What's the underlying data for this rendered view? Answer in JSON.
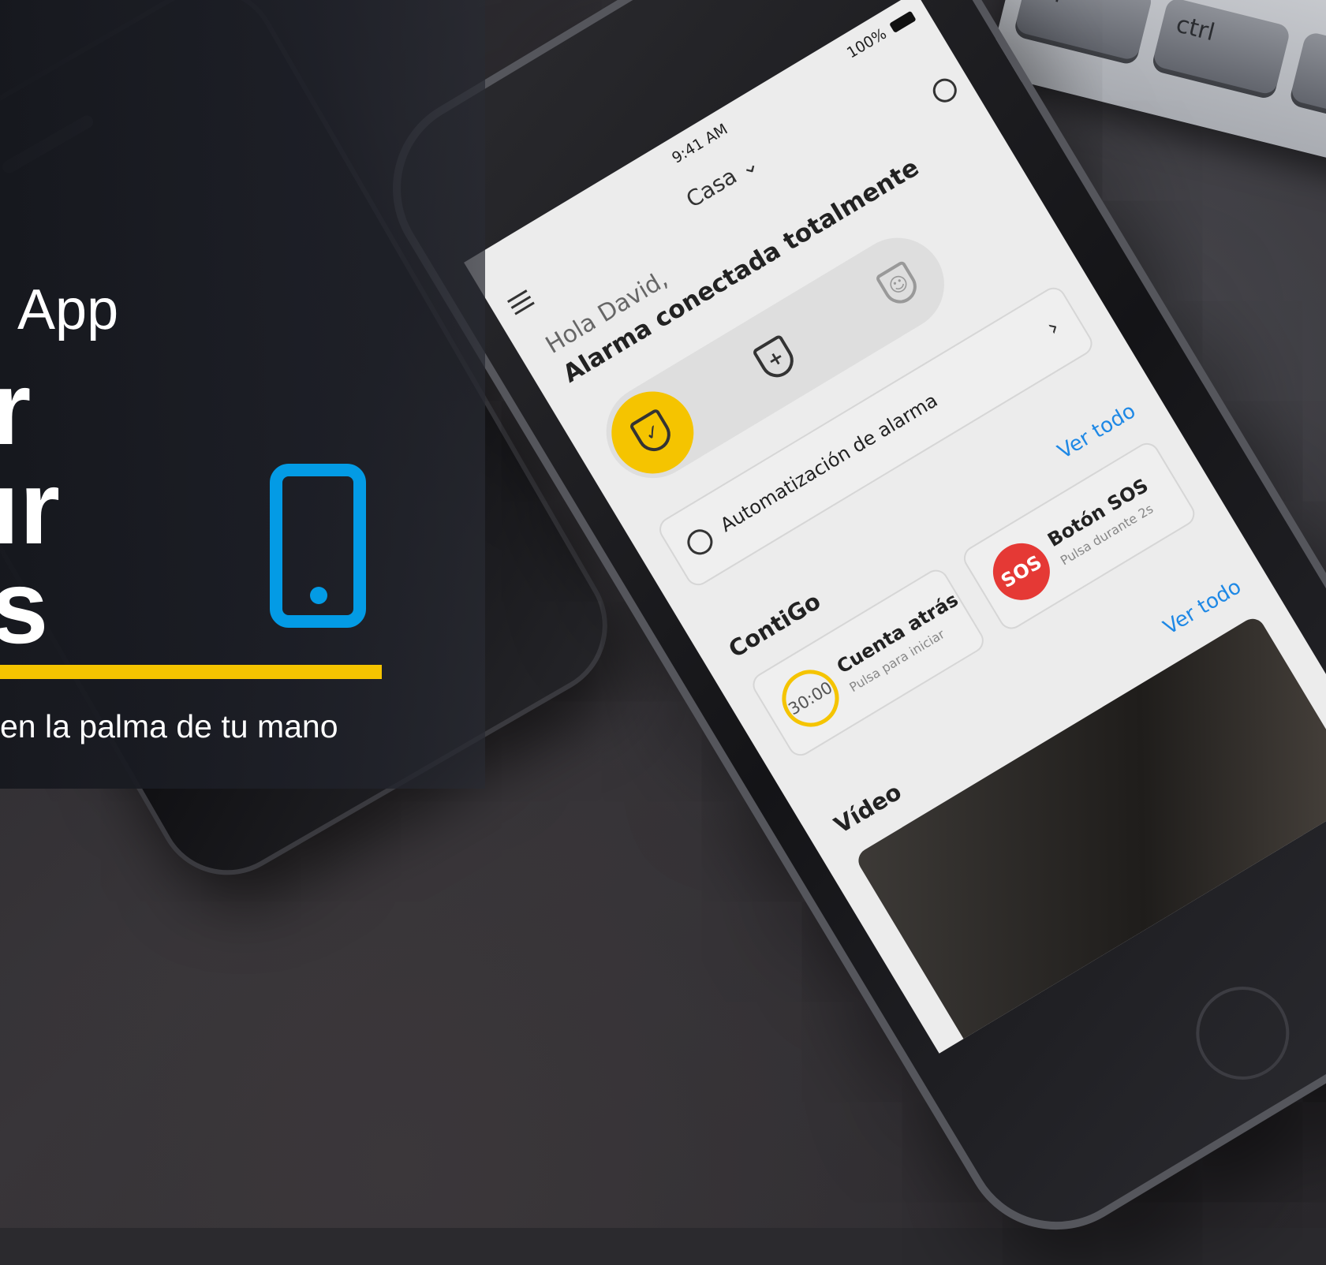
{
  "keyboard": {
    "keys": [
      "fn",
      "ctrl"
    ]
  },
  "phone": {
    "status_bar": {
      "time": "9:41 AM",
      "battery": "100%"
    },
    "location": "Casa",
    "greeting": "Hola David,",
    "alarm_status": "Alarma conectada totalmente",
    "automation": {
      "label": "Automatización de alarma"
    },
    "contigo": {
      "title": "ContiGo",
      "see_all": "Ver todo",
      "countdown": {
        "value": "30:00",
        "title": "Cuenta atrás",
        "subtitle": "Pulsa para iniciar"
      },
      "sos": {
        "badge": "SOS",
        "title": "Botón SOS",
        "subtitle": "Pulsa durante 2s"
      }
    },
    "video": {
      "title": "Vídeo",
      "see_all": "Ver todo"
    }
  },
  "overlay": {
    "app": "App",
    "line1": "r",
    "line2": "ır",
    "line3": "s",
    "tagline": "en la palma de tu mano"
  },
  "colors": {
    "accent_yellow": "#f5c400",
    "accent_blue": "#039be5",
    "sos_red": "#e53935"
  }
}
